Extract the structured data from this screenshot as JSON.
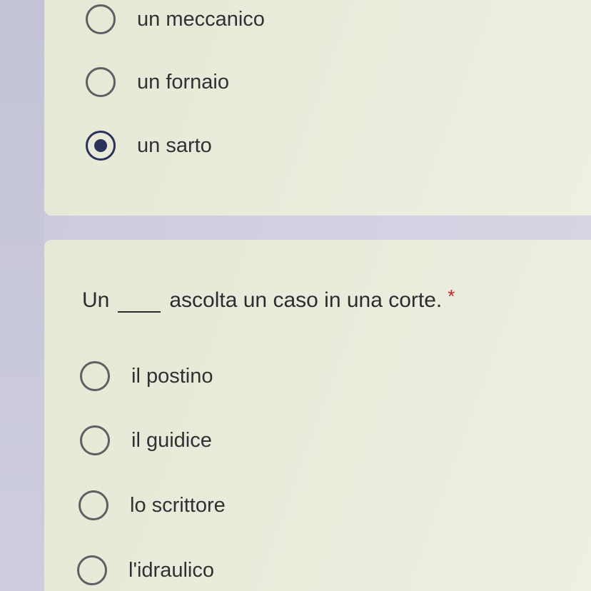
{
  "question_prev": {
    "options": [
      {
        "label": "un meccanico",
        "selected": false
      },
      {
        "label": "un fornaio",
        "selected": false
      },
      {
        "label": "un sarto",
        "selected": true
      }
    ]
  },
  "question_current": {
    "text_before": "Un",
    "text_after": "ascolta un caso in una corte.",
    "required_marker": "*",
    "options": [
      {
        "label": "il postino",
        "selected": false
      },
      {
        "label": "il guidice",
        "selected": false
      },
      {
        "label": "lo scrittore",
        "selected": false
      },
      {
        "label": "l'idraulico",
        "selected": false
      }
    ]
  },
  "colors": {
    "card_background": "#e9ecdb",
    "page_background": "#cfcfe0",
    "radio_selected": "#2b3159",
    "radio_unselected": "#5f6064",
    "required_star": "#c62828"
  }
}
